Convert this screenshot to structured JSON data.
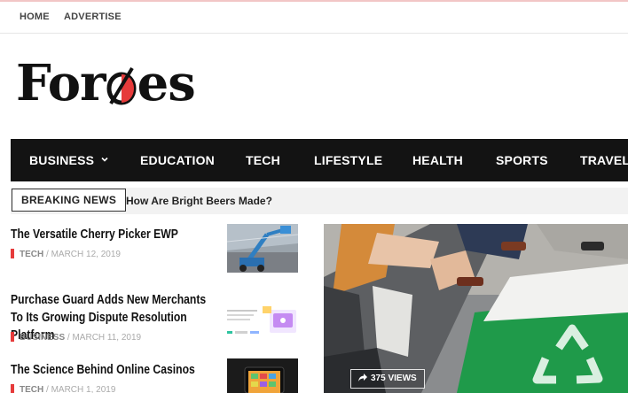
{
  "topbar": {
    "links": [
      "HOME",
      "ADVERTISE"
    ]
  },
  "logo": {
    "left": "For",
    "right": "es",
    "accent": "#e63b3b"
  },
  "nav": {
    "items": [
      "BUSINESS",
      "EDUCATION",
      "TECH",
      "LIFESTYLE",
      "HEALTH",
      "SPORTS",
      "TRAVEL"
    ],
    "dropdown_icon": "chevron-down-icon"
  },
  "breaking": {
    "label": "BREAKING NEWS",
    "headline": "How Are Bright Beers Made?"
  },
  "posts": [
    {
      "title": "The Versatile Cherry Picker EWP",
      "category": "TECH",
      "date": "MARCH 12, 2019"
    },
    {
      "title": "Purchase Guard Adds New Merchants To Its Growing Dispute Resolution Platform",
      "category": "BUSINESS",
      "date": "MARCH 11, 2019"
    },
    {
      "title": "The Science Behind Online Casinos",
      "category": "TECH",
      "date": "MARCH 1, 2019"
    }
  ],
  "hero": {
    "views": "375 VIEWS",
    "views_icon": "share-icon"
  },
  "colors": {
    "nav_bg": "#131313",
    "accent": "#e63b3b",
    "breaking_bg": "#f2f2f2"
  }
}
